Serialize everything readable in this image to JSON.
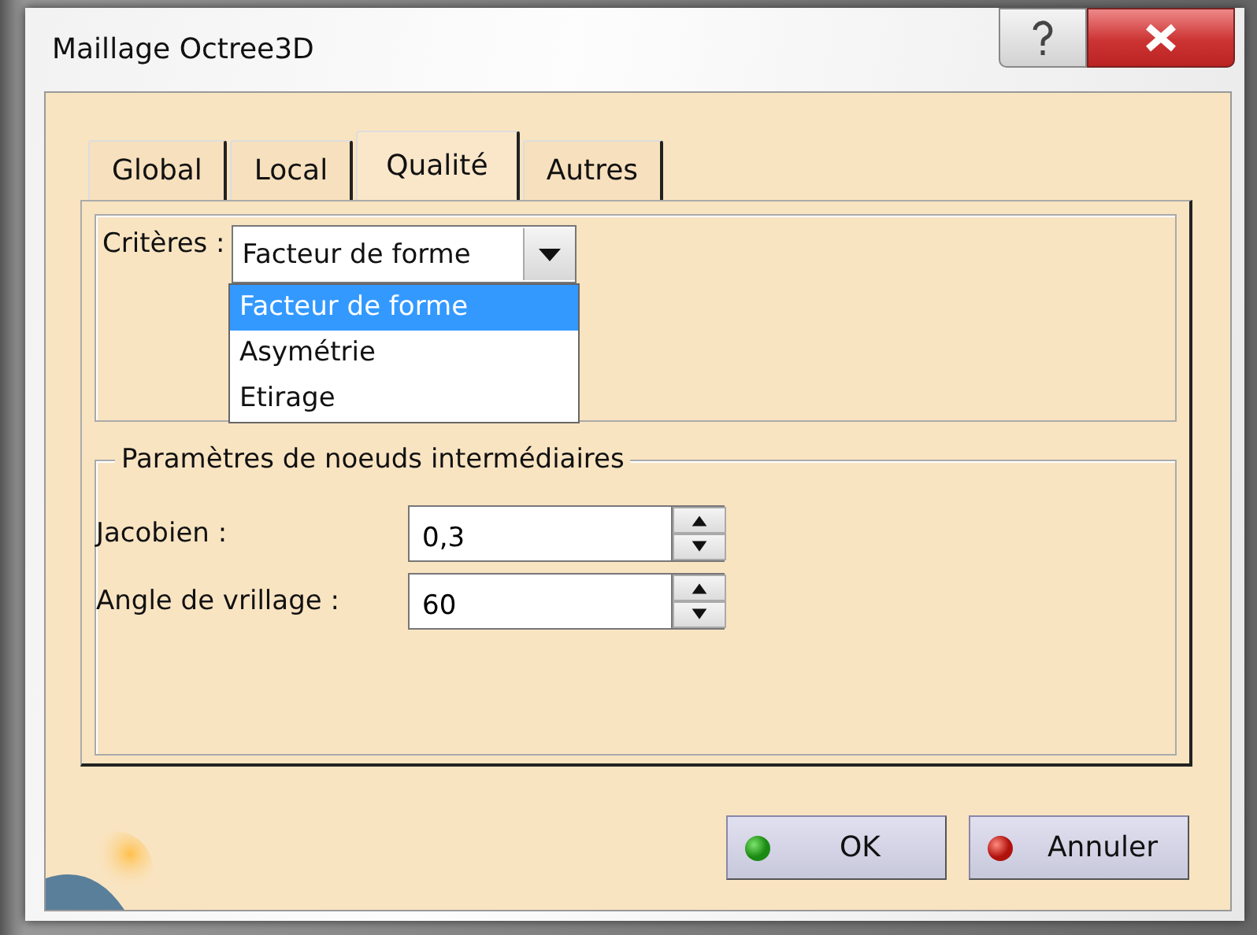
{
  "window": {
    "title": "Maillage Octree3D"
  },
  "tabs": [
    {
      "label": "Global",
      "selected": false
    },
    {
      "label": "Local",
      "selected": false
    },
    {
      "label": "Qualité",
      "selected": true
    },
    {
      "label": "Autres",
      "selected": false
    }
  ],
  "criteria": {
    "label": "Critères :",
    "value": "Facteur de forme",
    "expanded": true,
    "options": [
      {
        "label": "Facteur de forme",
        "selected": true
      },
      {
        "label": "Asymétrie",
        "selected": false
      },
      {
        "label": "Etirage",
        "selected": false
      }
    ]
  },
  "group": {
    "title": "Paramètres de noeuds intermédiaires",
    "fields": [
      {
        "label": "Jacobien :",
        "value": "0,3"
      },
      {
        "label": "Angle de vrillage :",
        "value": "60"
      }
    ]
  },
  "buttons": [
    {
      "label": "OK",
      "kind": "ok"
    },
    {
      "label": "Annuler",
      "kind": "cancel"
    }
  ]
}
